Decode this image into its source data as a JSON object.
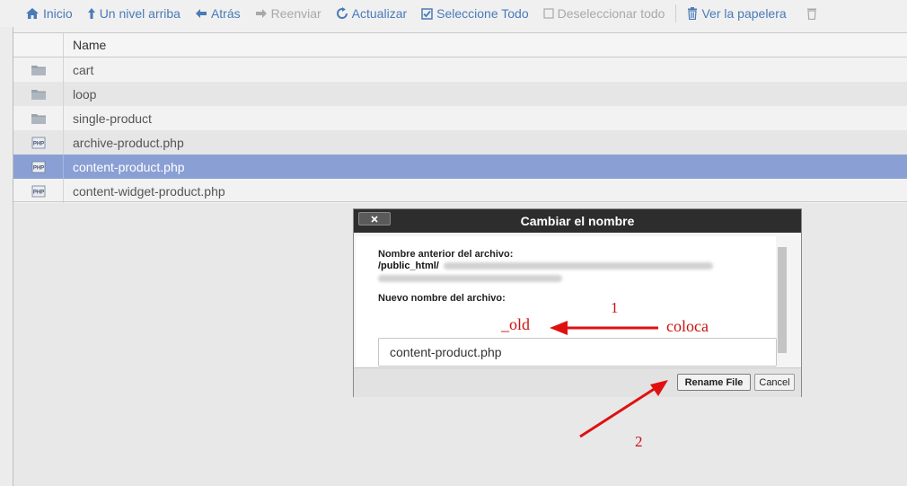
{
  "toolbar": {
    "home": "Inicio",
    "up": "Un nivel arriba",
    "back": "Atrás",
    "forward": "Reenviar",
    "reload": "Actualizar",
    "select_all": "Seleccione Todo",
    "deselect_all": "Deseleccionar todo",
    "trash": "Ver la papelera"
  },
  "table": {
    "header": "Name",
    "rows": [
      {
        "name": "cart",
        "type": "folder"
      },
      {
        "name": "loop",
        "type": "folder"
      },
      {
        "name": "single-product",
        "type": "folder"
      },
      {
        "name": "archive-product.php",
        "type": "php"
      },
      {
        "name": "content-product.php",
        "type": "php",
        "selected": true
      },
      {
        "name": "content-widget-product.php",
        "type": "php"
      }
    ]
  },
  "dialog": {
    "title": "Cambiar el nombre",
    "old_label": "Nombre anterior del archivo:",
    "old_path": "/public_html/",
    "new_label": "Nuevo nombre del archivo:",
    "new_value": "content-product.php",
    "rename_button": "Rename File",
    "cancel_button": "Cancel"
  },
  "annotations": {
    "suffix": "_old",
    "instruction": "coloca",
    "step1": "1",
    "step2": "2",
    "color": "#cc1111"
  },
  "colors": {
    "accent": "#4a7ab8",
    "selected_row": "#8a9fd4",
    "dialog_title": "#2d2d2d"
  }
}
